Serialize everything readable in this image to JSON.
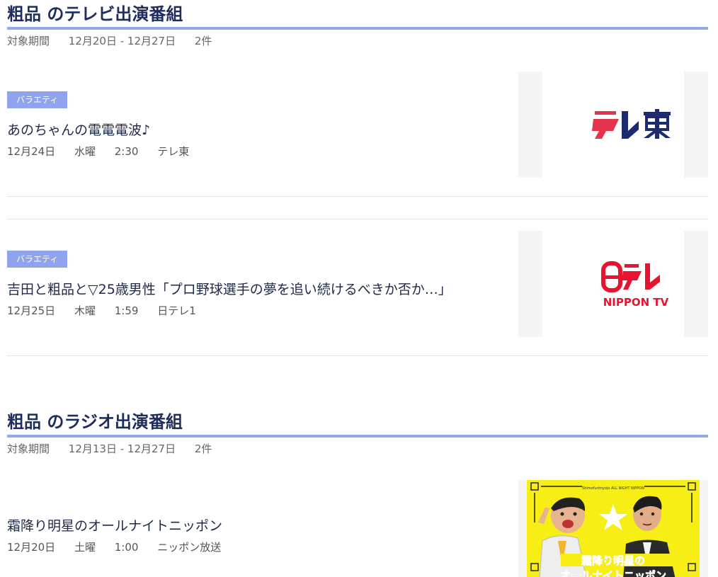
{
  "tv_section": {
    "title": "粗品 のテレビ出演番組",
    "period_label": "対象期間",
    "period_range": "12月20日 - 12月27日",
    "count": "2件",
    "programs": [
      {
        "genre": "バラエティ",
        "title": "あのちゃんの電電電波♪",
        "date": "12月24日",
        "weekday": "水曜",
        "time": "2:30",
        "channel": "テレ東",
        "logo": {
          "text": "テレ東",
          "primary_color": "#1e2a6e",
          "accent_color": "#e6334d"
        }
      },
      {
        "genre": "バラエティ",
        "title": "吉田と粗品と▽25歳男性「プロ野球選手の夢を追い続けるべきか否か…」",
        "date": "12月25日",
        "weekday": "木曜",
        "time": "1:59",
        "channel": "日テレ1",
        "logo": {
          "text": "日テレ",
          "subtext": "NIPPON TV",
          "color": "#e8132e"
        }
      }
    ]
  },
  "radio_section": {
    "title": "粗品 のラジオ出演番組",
    "period_label": "対象期間",
    "period_range": "12月13日 - 12月27日",
    "count": "2件",
    "programs": [
      {
        "title": "霜降り明星のオールナイトニッポン",
        "date": "12月20日",
        "weekday": "土曜",
        "time": "1:00",
        "channel": "ニッポン放送",
        "art": {
          "top_text": "Shimofurimyojo ALL NIGHT NIPPON",
          "title_text": "霜降り明星の",
          "title_text_2": "オールナイトニッポン",
          "bg_color": "#f7ee16"
        }
      }
    ]
  },
  "colors": {
    "heading": "#1f2d5c",
    "underline": "#96a8eb",
    "genre_bg": "#8fa4ec"
  }
}
